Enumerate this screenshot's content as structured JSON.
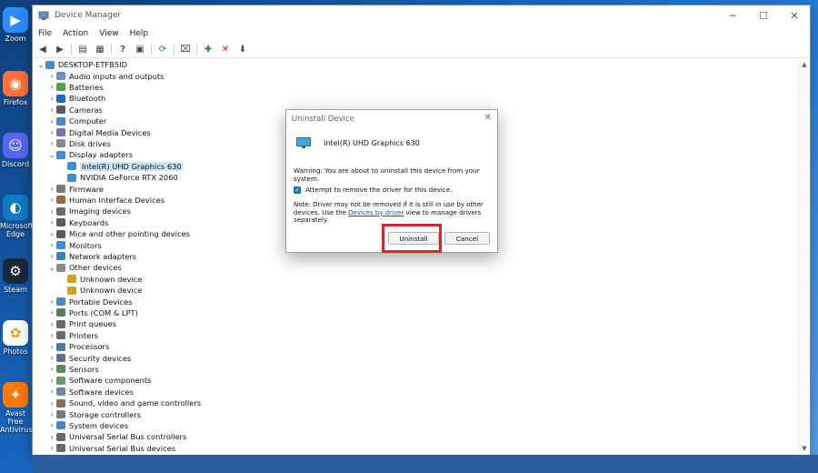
{
  "desktop": {
    "icons": [
      {
        "label": "Zoom",
        "glyph": "video-camera-icon",
        "color": "#2d8cff"
      },
      {
        "label": "Firefox",
        "glyph": "firefox-icon",
        "color": "#ff7139"
      },
      {
        "label": "Discord",
        "glyph": "discord-icon",
        "color": "#5865f2"
      },
      {
        "label": "Microsoft\nEdge",
        "glyph": "edge-icon",
        "color": "#0f7bc4"
      },
      {
        "label": "Steam",
        "glyph": "steam-icon",
        "color": "#1b2838"
      },
      {
        "label": "Photos",
        "glyph": "pinwheel-icon",
        "color": "#ffffff"
      },
      {
        "label": "Avast Free\nAntivirus",
        "glyph": "avast-icon",
        "color": "#ff7800"
      }
    ]
  },
  "window": {
    "title": "Device Manager",
    "controls": {
      "minimize": "─",
      "maximize": "☐",
      "close": "✕"
    },
    "menu": [
      "File",
      "Action",
      "View",
      "Help"
    ]
  },
  "tree": {
    "root": "DESKTOP-ETFB5ID",
    "items": [
      {
        "label": "Audio inputs and outputs",
        "level": 1,
        "expanded": false
      },
      {
        "label": "Batteries",
        "level": 1,
        "expanded": false
      },
      {
        "label": "Bluetooth",
        "level": 1,
        "expanded": false
      },
      {
        "label": "Cameras",
        "level": 1,
        "expanded": false
      },
      {
        "label": "Computer",
        "level": 1,
        "expanded": false
      },
      {
        "label": "Digital Media Devices",
        "level": 1,
        "expanded": false
      },
      {
        "label": "Disk drives",
        "level": 1,
        "expanded": false
      },
      {
        "label": "Display adapters",
        "level": 1,
        "expanded": true
      },
      {
        "label": "Intel(R) UHD Graphics 630",
        "level": 2,
        "selected": true
      },
      {
        "label": "NVIDIA GeForce RTX 2060",
        "level": 2
      },
      {
        "label": "Firmware",
        "level": 1,
        "expanded": false
      },
      {
        "label": "Human Interface Devices",
        "level": 1,
        "expanded": false
      },
      {
        "label": "Imaging devices",
        "level": 1,
        "expanded": false
      },
      {
        "label": "Keyboards",
        "level": 1,
        "expanded": false
      },
      {
        "label": "Mice and other pointing devices",
        "level": 1,
        "expanded": false
      },
      {
        "label": "Monitors",
        "level": 1,
        "expanded": false
      },
      {
        "label": "Network adapters",
        "level": 1,
        "expanded": false
      },
      {
        "label": "Other devices",
        "level": 1,
        "expanded": true
      },
      {
        "label": "Unknown device",
        "level": 2
      },
      {
        "label": "Unknown device",
        "level": 2
      },
      {
        "label": "Portable Devices",
        "level": 1,
        "expanded": false
      },
      {
        "label": "Ports (COM & LPT)",
        "level": 1,
        "expanded": false
      },
      {
        "label": "Print queues",
        "level": 1,
        "expanded": false
      },
      {
        "label": "Printers",
        "level": 1,
        "expanded": false
      },
      {
        "label": "Processors",
        "level": 1,
        "expanded": false
      },
      {
        "label": "Security devices",
        "level": 1,
        "expanded": false
      },
      {
        "label": "Sensors",
        "level": 1,
        "expanded": false
      },
      {
        "label": "Software components",
        "level": 1,
        "expanded": false
      },
      {
        "label": "Software devices",
        "level": 1,
        "expanded": false
      },
      {
        "label": "Sound, video and game controllers",
        "level": 1,
        "expanded": false
      },
      {
        "label": "Storage controllers",
        "level": 1,
        "expanded": false
      },
      {
        "label": "System devices",
        "level": 1,
        "expanded": false
      },
      {
        "label": "Universal Serial Bus controllers",
        "level": 1,
        "expanded": false
      },
      {
        "label": "Universal Serial Bus devices",
        "level": 1,
        "expanded": false
      }
    ]
  },
  "dialog": {
    "title": "Uninstall Device",
    "device_name": "Intel(R) UHD Graphics 630",
    "warning": "Warning: You are about to uninstall this device from your system.",
    "checkbox_label": "Attempt to remove the driver for this device.",
    "checkbox_checked": true,
    "note_before": "Note: Driver may not be removed if it is still in use by other devices. Use the ",
    "note_link": "Devices by driver",
    "note_after": " view to manage drivers separately.",
    "uninstall_label": "Uninstall",
    "cancel_label": "Cancel"
  },
  "colors": {
    "accent": "#1a6fc9",
    "highlight": "#d9262d",
    "selection": "#cce4f7"
  }
}
